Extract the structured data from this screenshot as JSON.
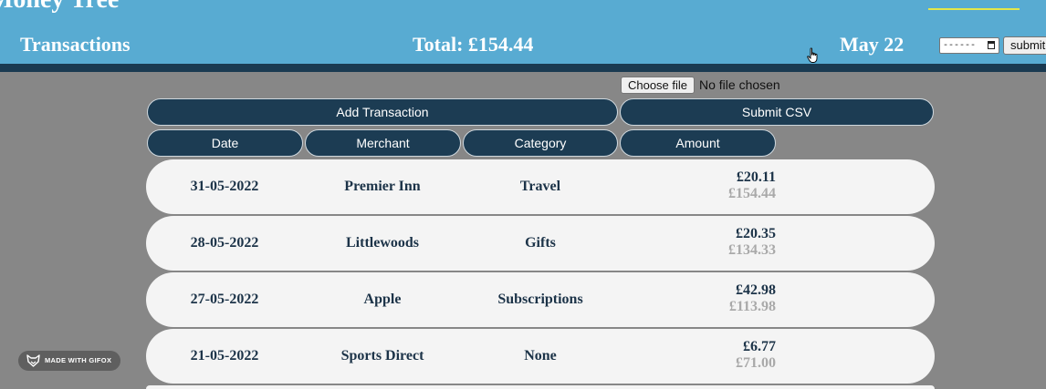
{
  "header": {
    "app_title": "Money Tree",
    "section_title": "Transactions",
    "total": "Total: £154.44",
    "month": "May 22",
    "date_placeholder": "------",
    "submit_label": "submit"
  },
  "upload": {
    "choose_file_label": "Choose file",
    "file_status": "No file chosen",
    "add_transaction_label": "Add Transaction",
    "submit_csv_label": "Submit CSV"
  },
  "columns": [
    "Date",
    "Merchant",
    "Category",
    "Amount"
  ],
  "transactions": [
    {
      "date": "31-05-2022",
      "merchant": "Premier Inn",
      "category": "Travel",
      "amount": "£20.11",
      "running_total": "£154.44"
    },
    {
      "date": "28-05-2022",
      "merchant": "Littlewoods",
      "category": "Gifts",
      "amount": "£20.35",
      "running_total": "£134.33"
    },
    {
      "date": "27-05-2022",
      "merchant": "Apple",
      "category": "Subscriptions",
      "amount": "£42.98",
      "running_total": "£113.98"
    },
    {
      "date": "21-05-2022",
      "merchant": "Sports Direct",
      "category": "None",
      "amount": "£6.77",
      "running_total": "£71.00"
    }
  ],
  "watermark": "MADE WITH GIFOX",
  "icons": {
    "cursor": "hand-pointer-icon",
    "calendar": "calendar-icon",
    "fox": "fox-logo-icon"
  },
  "colors": {
    "header": "#58abd2",
    "navy": "#1c3c53",
    "background": "#878787",
    "row": "#f4f4f4",
    "muted": "#a9a9a9"
  }
}
